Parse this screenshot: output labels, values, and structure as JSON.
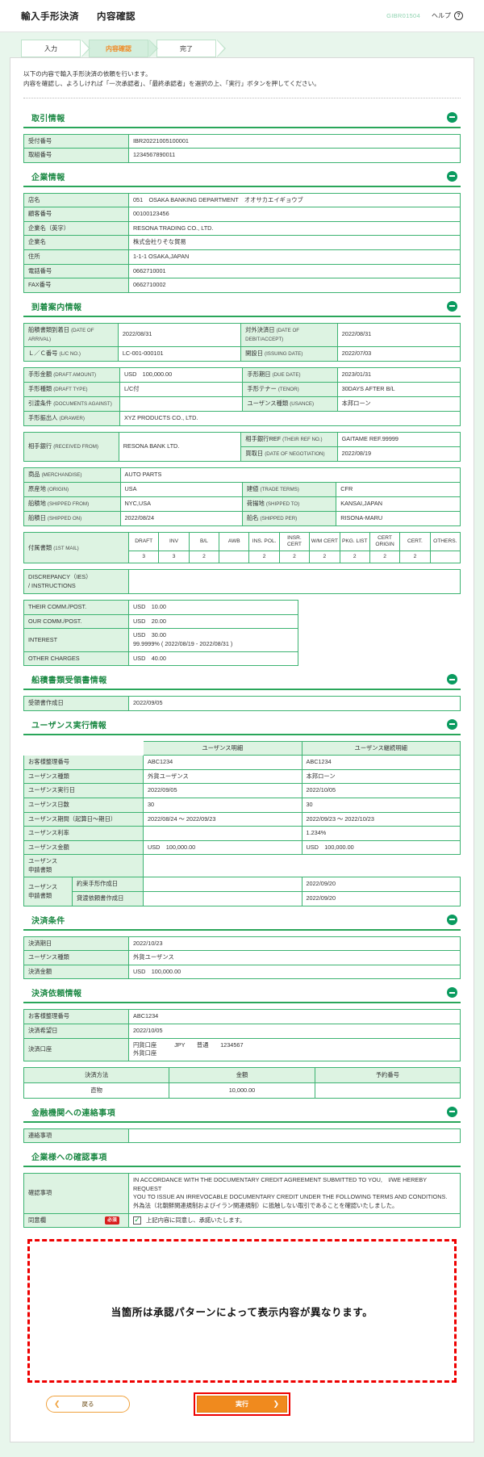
{
  "header": {
    "title": "輸入手形決済",
    "subtitle": "内容確認",
    "screen_id": "GIBR01504",
    "help_label": "ヘルプ",
    "help_icon": "question-mark"
  },
  "steps": [
    {
      "label": "入力",
      "active": false
    },
    {
      "label": "内容確認",
      "active": true
    },
    {
      "label": "完了",
      "active": false
    }
  ],
  "intro": {
    "line1": "以下の内容で輸入手形決済の依頼を行います。",
    "line2": "内容を確認し、よろしければ「一次承認者」、「最終承認者」を選択の上、「実行」ボタンを押してください。"
  },
  "sections": {
    "transaction": {
      "title": "取引情報",
      "rows": [
        {
          "label": "受付番号",
          "value": "IBR20221005100001"
        },
        {
          "label": "取組番号",
          "value": "1234567890011"
        }
      ]
    },
    "company": {
      "title": "企業情報",
      "rows": [
        {
          "label": "店名",
          "value": "051　OSAKA BANKING DEPARTMENT　オオサカエイギョウブ"
        },
        {
          "label": "顧客番号",
          "value": "00100123456"
        },
        {
          "label": "企業名（英字）",
          "value": "RESONA TRADING CO., LTD."
        },
        {
          "label": "企業名",
          "value": "株式会社りそな貿易"
        },
        {
          "label": "住所",
          "value": "1-1-1 OSAKA,JAPAN"
        },
        {
          "label": "電話番号",
          "value": "0662710001"
        },
        {
          "label": "FAX番号",
          "value": "0662710002"
        }
      ]
    },
    "arrival": {
      "title": "到着案内情報",
      "block1": [
        {
          "l1": "船積書類到着日",
          "e1": "(DATE OF ARRIVAL)",
          "v1": "2022/08/31",
          "l2": "対外決済日",
          "e2": "(DATE OF DEBIT/ACCEPT)",
          "v2": "2022/08/31"
        },
        {
          "l1": "Ｌ／Ｃ番号",
          "e1": "(L/C NO.)",
          "v1": "LC-001-000101",
          "l2": "開設日",
          "e2": "(ISSUING DATE)",
          "v2": "2022/07/03"
        }
      ],
      "block2": [
        {
          "l1": "手形金額",
          "e1": "(DRAFT AMOUNT)",
          "v1": "USD　100,000.00",
          "l2": "手形期日",
          "e2": "(DUE DATE)",
          "v2": "2023/01/31"
        },
        {
          "l1": "手形種類",
          "e1": "(DRAFT TYPE)",
          "v1": "L/C付",
          "l2": "手形テナー",
          "e2": "(TENOR)",
          "v2": "30DAYS AFTER B/L"
        },
        {
          "l1": "引渡条件",
          "e1": "(DOCUMENTS AGAINST)",
          "v1": "",
          "l2": "ユーザンス種類",
          "e2": "(USANCE)",
          "v2": "本邦ローン"
        }
      ],
      "drawer": {
        "label": "手形振出人",
        "en": "(DRAWER)",
        "value": "XYZ PRODUCTS CO., LTD."
      },
      "block3": {
        "received_from": {
          "label": "相手銀行",
          "en": "(RECEIVED FROM)",
          "value": "RESONA BANK LTD."
        },
        "their_ref": {
          "label": "相手銀行REF",
          "en": "(THEIR REF NO.)",
          "value": "GAITAME REF.99999"
        },
        "negotiation": {
          "label": "買取日",
          "en": "(DATE OF NEGOTIATION)",
          "value": "2022/08/19"
        }
      },
      "block4": {
        "merchandise": {
          "label": "商品",
          "en": "(MERCHANDISE)",
          "value": "AUTO PARTS"
        },
        "rows": [
          {
            "l1": "原産地",
            "e1": "(ORIGIN)",
            "v1": "USA",
            "l2": "建値",
            "e2": "(TRADE TERMS)",
            "v2": "CFR"
          },
          {
            "l1": "船積地",
            "e1": "(SHIPPED FROM)",
            "v1": "NYC,USA",
            "l2": "荷揚地",
            "e2": "(SHIPPED TO)",
            "v2": "KANSAI,JAPAN"
          },
          {
            "l1": "船積日",
            "e1": "(SHIPPED ON)",
            "v1": "2022/08/24",
            "l2": "船名",
            "e2": "(SHIPPED PER)",
            "v2": "RISONA-MARU"
          }
        ]
      },
      "documents": {
        "label": "付属書類",
        "en": "(1ST MAIL)",
        "columns": [
          "DRAFT",
          "INV",
          "B/L",
          "AWB",
          "INS. POL.",
          "INSR. CERT",
          "W/M CERT",
          "PKG. LIST",
          "CERT ORIGIN",
          "CERT.",
          "OTHERS."
        ],
        "values": [
          "3",
          "3",
          "2",
          "",
          "2",
          "2",
          "2",
          "2",
          "2",
          "2",
          ""
        ]
      },
      "discrepancy": {
        "label_line1": "DISCREPANCY（IES）",
        "label_line2": "/ INSTRUCTIONS",
        "value": ""
      },
      "charges": [
        {
          "label": "THEIR COMM./POST.",
          "value": "USD　10.00",
          "value2": ""
        },
        {
          "label": "OUR COMM./POST.",
          "value": "USD　20.00",
          "value2": ""
        },
        {
          "label": "INTEREST",
          "value": "USD　30.00",
          "value2": "99.9999% ( 2022/08/19 - 2022/08/31 )"
        },
        {
          "label": "OTHER CHARGES",
          "value": "USD　40.00",
          "value2": ""
        }
      ]
    },
    "shipping_receipt": {
      "title": "船積書類受領書情報",
      "rows": [
        {
          "label": "受領書作成日",
          "value": "2022/09/05"
        }
      ]
    },
    "usance": {
      "title": "ユーザンス実行情報",
      "col1": "ユーザンス明細",
      "col2": "ユーザンス継続明細",
      "rows": [
        {
          "label": "お客様整理番号",
          "v1": "ABC1234",
          "v2": "ABC1234"
        },
        {
          "label": "ユーザンス種類",
          "v1": "外貨ユーザンス",
          "v2": "本邦ローン"
        },
        {
          "label": "ユーザンス実行日",
          "v1": "2022/09/05",
          "v2": "2022/10/05"
        },
        {
          "label": "ユーザンス日数",
          "v1": "30",
          "v2": "30"
        },
        {
          "label": "ユーザンス期間（起算日～期日）",
          "v1": "2022/08/24 ～ 2022/09/23",
          "v2": "2022/09/23 ～ 2022/10/23"
        },
        {
          "label": "ユーザンス利率",
          "v1": "",
          "v2": "1.234%"
        },
        {
          "label": "ユーザンス金額",
          "v1": "USD　100,000.00",
          "v2": "USD　100,000.00"
        }
      ],
      "docs_group_label_l1": "ユーザンス",
      "docs_group_label_l2": "申請書類",
      "docs_rows": [
        {
          "label": "約束手形作成日",
          "v1": "",
          "v2": "2022/09/20"
        },
        {
          "label": "貸渡依頼書作成日",
          "v1": "",
          "v2": "2022/09/20"
        }
      ]
    },
    "settlement_terms": {
      "title": "決済条件",
      "rows": [
        {
          "label": "決済期日",
          "value": "2022/10/23"
        },
        {
          "label": "ユーザンス種類",
          "value": "外貨ユーザンス"
        },
        {
          "label": "決済金額",
          "value": "USD　100,000.00"
        }
      ]
    },
    "settlement_request": {
      "title": "決済依頼情報",
      "rows": [
        {
          "label": "お客様整理番号",
          "value": "ABC1234"
        },
        {
          "label": "決済希望日",
          "value": "2022/10/05"
        }
      ],
      "account": {
        "label": "決済口座",
        "line1": "円貨口座　　　JPY　　普通　　1234567",
        "line2": "外貨口座"
      },
      "pay_table": {
        "headers": [
          "決済方法",
          "金額",
          "予約番号"
        ],
        "rows": [
          [
            "直物",
            "10,000.00",
            ""
          ]
        ]
      }
    },
    "bank_message": {
      "title": "金融機関への連絡事項",
      "rows": [
        {
          "label": "連絡事項",
          "value": ""
        }
      ]
    },
    "company_confirm": {
      "title": "企業様への確認事項",
      "confirm_label": "確認事項",
      "confirm_text_l1": "IN ACCORDANCE WITH THE DOCUMENTARY CREDIT AGREEMENT SUBMITTED TO YOU,　I/WE HEREBY REQUEST",
      "confirm_text_l2": "YOU TO ISSUE AN IRREVOCABLE DOCUMENTARY CREDIT UNDER THE FOLLOWING TERMS AND CONDITIONS.",
      "confirm_text_l3": "外為法（北朝鮮関連規制およびイラン関連規制）に抵触しない取引であることを確認いたしました。",
      "agree_label": "同意欄",
      "required_badge": "必須",
      "agree_checkbox_checked": true,
      "agree_text": "上記内容に同意し、承諾いたします。"
    }
  },
  "notice": {
    "text": "当箇所は承認パターンによって表示内容が異なります。"
  },
  "buttons": {
    "back": "戻る",
    "execute": "実行"
  },
  "colors": {
    "accent_green": "#1e8a46",
    "table_border": "#3cb371",
    "label_bg": "#ddf3e2",
    "orange": "#f08a1e",
    "red": "#ee0000"
  }
}
